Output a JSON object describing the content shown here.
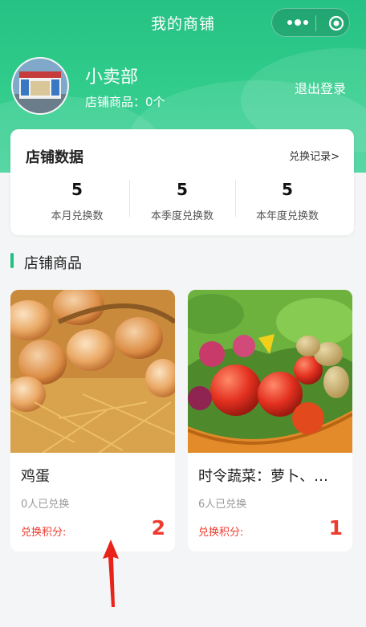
{
  "nav": {
    "title": "我的商铺"
  },
  "shop": {
    "name": "小卖部",
    "goods_label": "店铺商品：",
    "goods_count": "0个",
    "logout": "退出登录"
  },
  "stats": {
    "title": "店铺数据",
    "link": "兑换记录>",
    "items": [
      {
        "value": "5",
        "label": "本月兑换数"
      },
      {
        "value": "5",
        "label": "本季度兑换数"
      },
      {
        "value": "5",
        "label": "本年度兑换数"
      }
    ]
  },
  "section": {
    "title": "店铺商品"
  },
  "products": [
    {
      "name": "鸡蛋",
      "redeemed": "0人已兑换",
      "points_label": "兑换积分:",
      "points": "2"
    },
    {
      "name": "时令蔬菜：萝卜、…",
      "redeemed": "6人已兑换",
      "points_label": "兑换积分:",
      "points": "1"
    }
  ],
  "colors": {
    "brand": "#26c184",
    "accent_red": "#ee3b2f"
  },
  "icons": {
    "more": "more-dots-icon",
    "close": "target-circle-icon"
  }
}
